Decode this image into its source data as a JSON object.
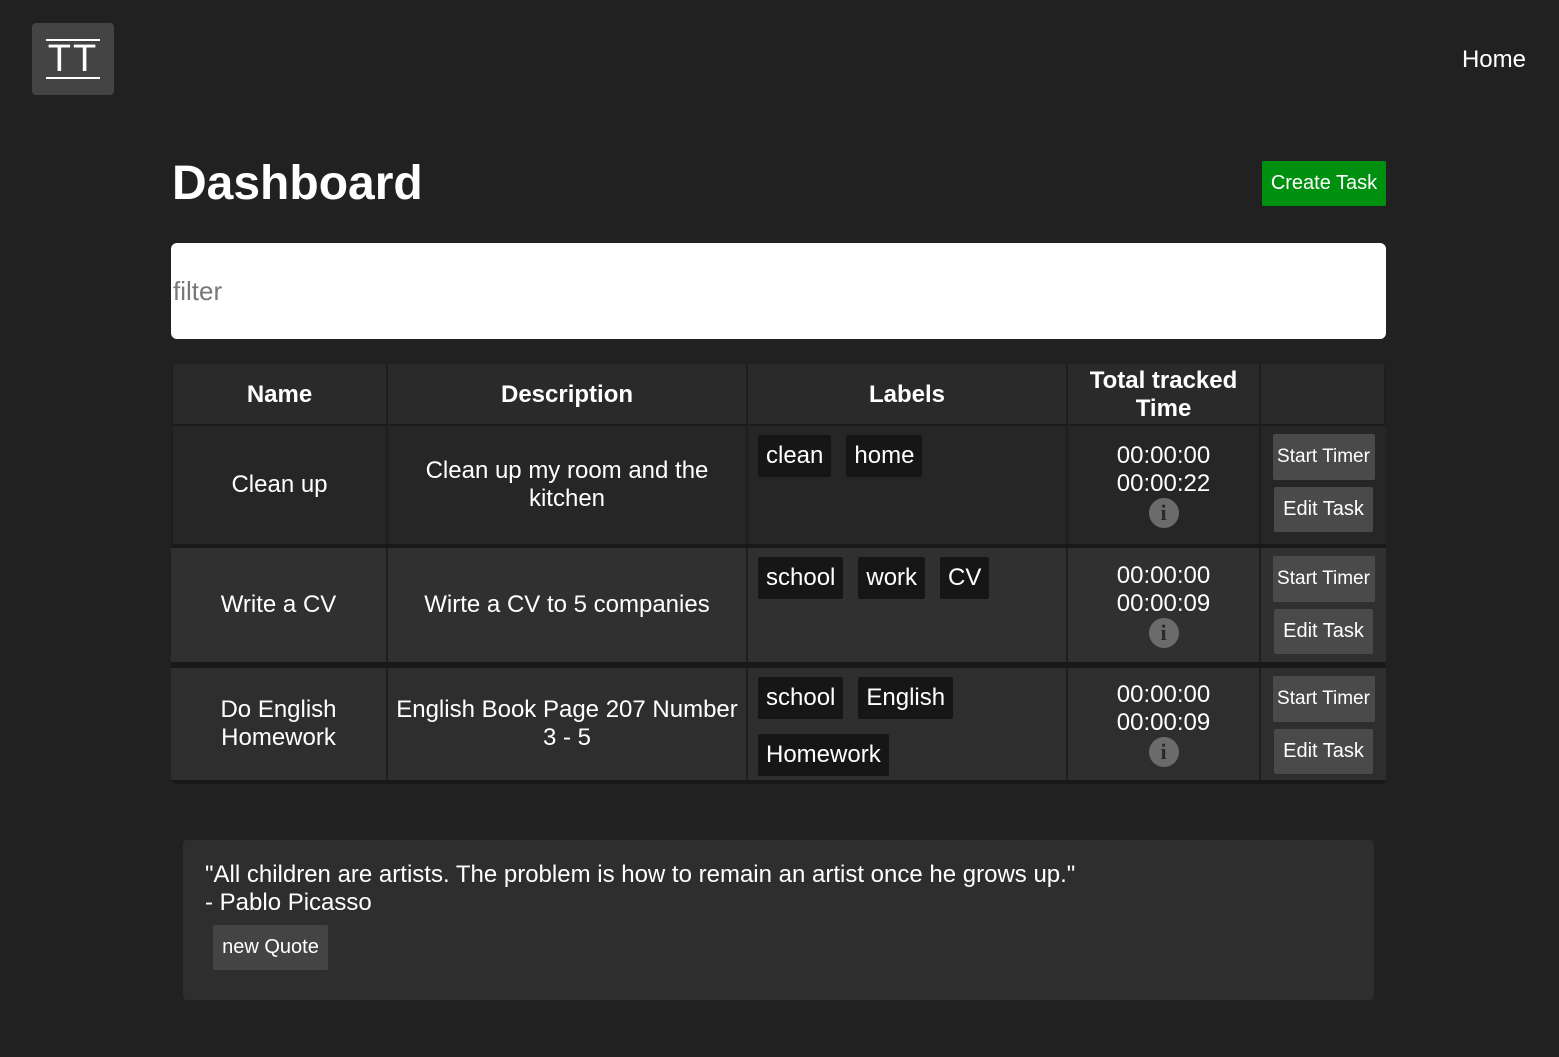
{
  "logo": {
    "text": "TT"
  },
  "nav": {
    "home_label": "Home"
  },
  "page": {
    "title": "Dashboard",
    "create_label": "Create Task"
  },
  "filter": {
    "placeholder": "filter",
    "value": ""
  },
  "table": {
    "headers": [
      "Name",
      "Description",
      "Labels",
      "Total tracked Time",
      ""
    ],
    "rows": [
      {
        "name": "Clean up",
        "description": "Clean up my room and the kitchen",
        "labels": [
          "clean",
          "home"
        ],
        "times": [
          "00:00:00",
          "00:00:22"
        ],
        "start_label": "Start Timer",
        "edit_label": "Edit Task"
      },
      {
        "name": "Write a CV",
        "description": "Wirte a CV to 5 companies",
        "labels": [
          "school",
          "work",
          "CV"
        ],
        "times": [
          "00:00:00",
          "00:00:09"
        ],
        "start_label": "Start Timer",
        "edit_label": "Edit Task"
      },
      {
        "name": "Do English Homework",
        "description": "English Book Page 207 Number 3 - 5",
        "labels": [
          "school",
          "English",
          "Homework"
        ],
        "times": [
          "00:00:00",
          "00:00:09"
        ],
        "start_label": "Start Timer",
        "edit_label": "Edit Task"
      }
    ],
    "info_icon": "info-icon"
  },
  "quote": {
    "text": "\"All children are artists. The problem is how to remain an artist once he grows up.\"",
    "author": "- Pablo Picasso",
    "button_label": "new Quote"
  },
  "colors": {
    "background": "#212121",
    "create_button": "#00900f",
    "tag_background": "#161616",
    "button_background": "#4a4a4a"
  }
}
